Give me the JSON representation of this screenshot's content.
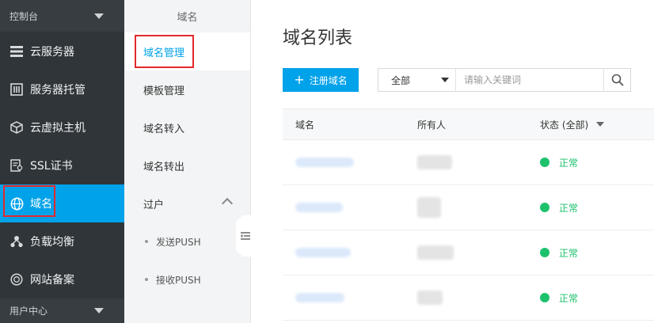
{
  "sidebar": {
    "console_label": "控制台",
    "user_center_label": "用户中心",
    "items": [
      {
        "label": "云服务器",
        "icon": "server-icon"
      },
      {
        "label": "服务器托管",
        "icon": "hosting-icon"
      },
      {
        "label": "云虚拟主机",
        "icon": "cube-icon"
      },
      {
        "label": "SSL证书",
        "icon": "certificate-icon"
      },
      {
        "label": "域名",
        "icon": "globe-icon"
      },
      {
        "label": "负载均衡",
        "icon": "load-balancer-icon"
      },
      {
        "label": "网站备案",
        "icon": "record-icon"
      }
    ],
    "active_index": 4
  },
  "submenu": {
    "title": "域名",
    "items": [
      "域名管理",
      "模板管理",
      "域名转入",
      "域名转出",
      "过户"
    ],
    "children": [
      "发送PUSH",
      "接收PUSH"
    ]
  },
  "main": {
    "title": "域名列表",
    "add_button": "注册域名",
    "search": {
      "scope": "全部",
      "placeholder": "请输入关键词"
    },
    "table": {
      "headers": [
        "域名",
        "所有人",
        "状态 (全部)"
      ],
      "rows": [
        {
          "status": "正常"
        },
        {
          "status": "正常"
        },
        {
          "status": "正常"
        },
        {
          "status": "正常"
        }
      ]
    }
  },
  "colors": {
    "accent": "#00a2ea",
    "sidebar_bg": "#2f3539",
    "highlight": "#e2292c",
    "status_ok": "#1dc16c"
  }
}
